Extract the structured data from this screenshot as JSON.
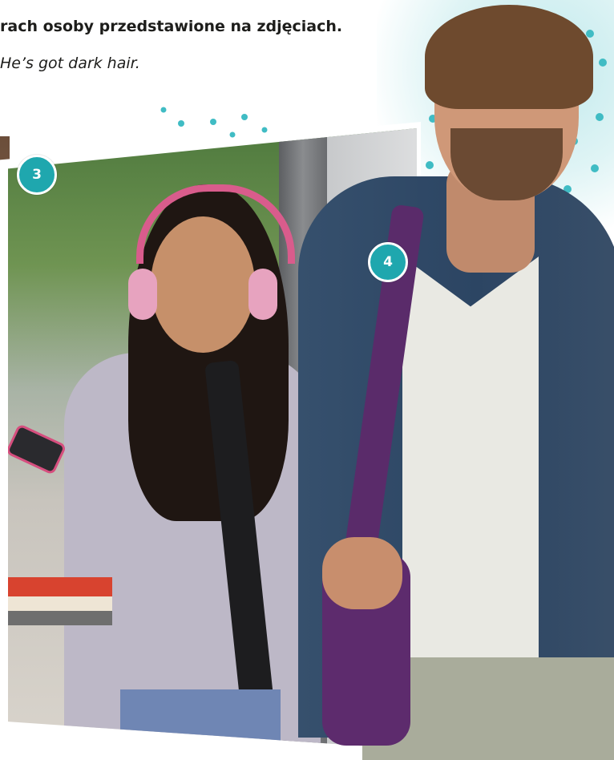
{
  "exercise": {
    "instruction": "rach osoby przedstawione na zdjęciach.",
    "example": "He’s got dark hair."
  },
  "photos": [
    {
      "number": "3"
    },
    {
      "number": "4"
    }
  ],
  "colors": {
    "accent": "#1fa7ae",
    "text": "#1d1d1b"
  }
}
